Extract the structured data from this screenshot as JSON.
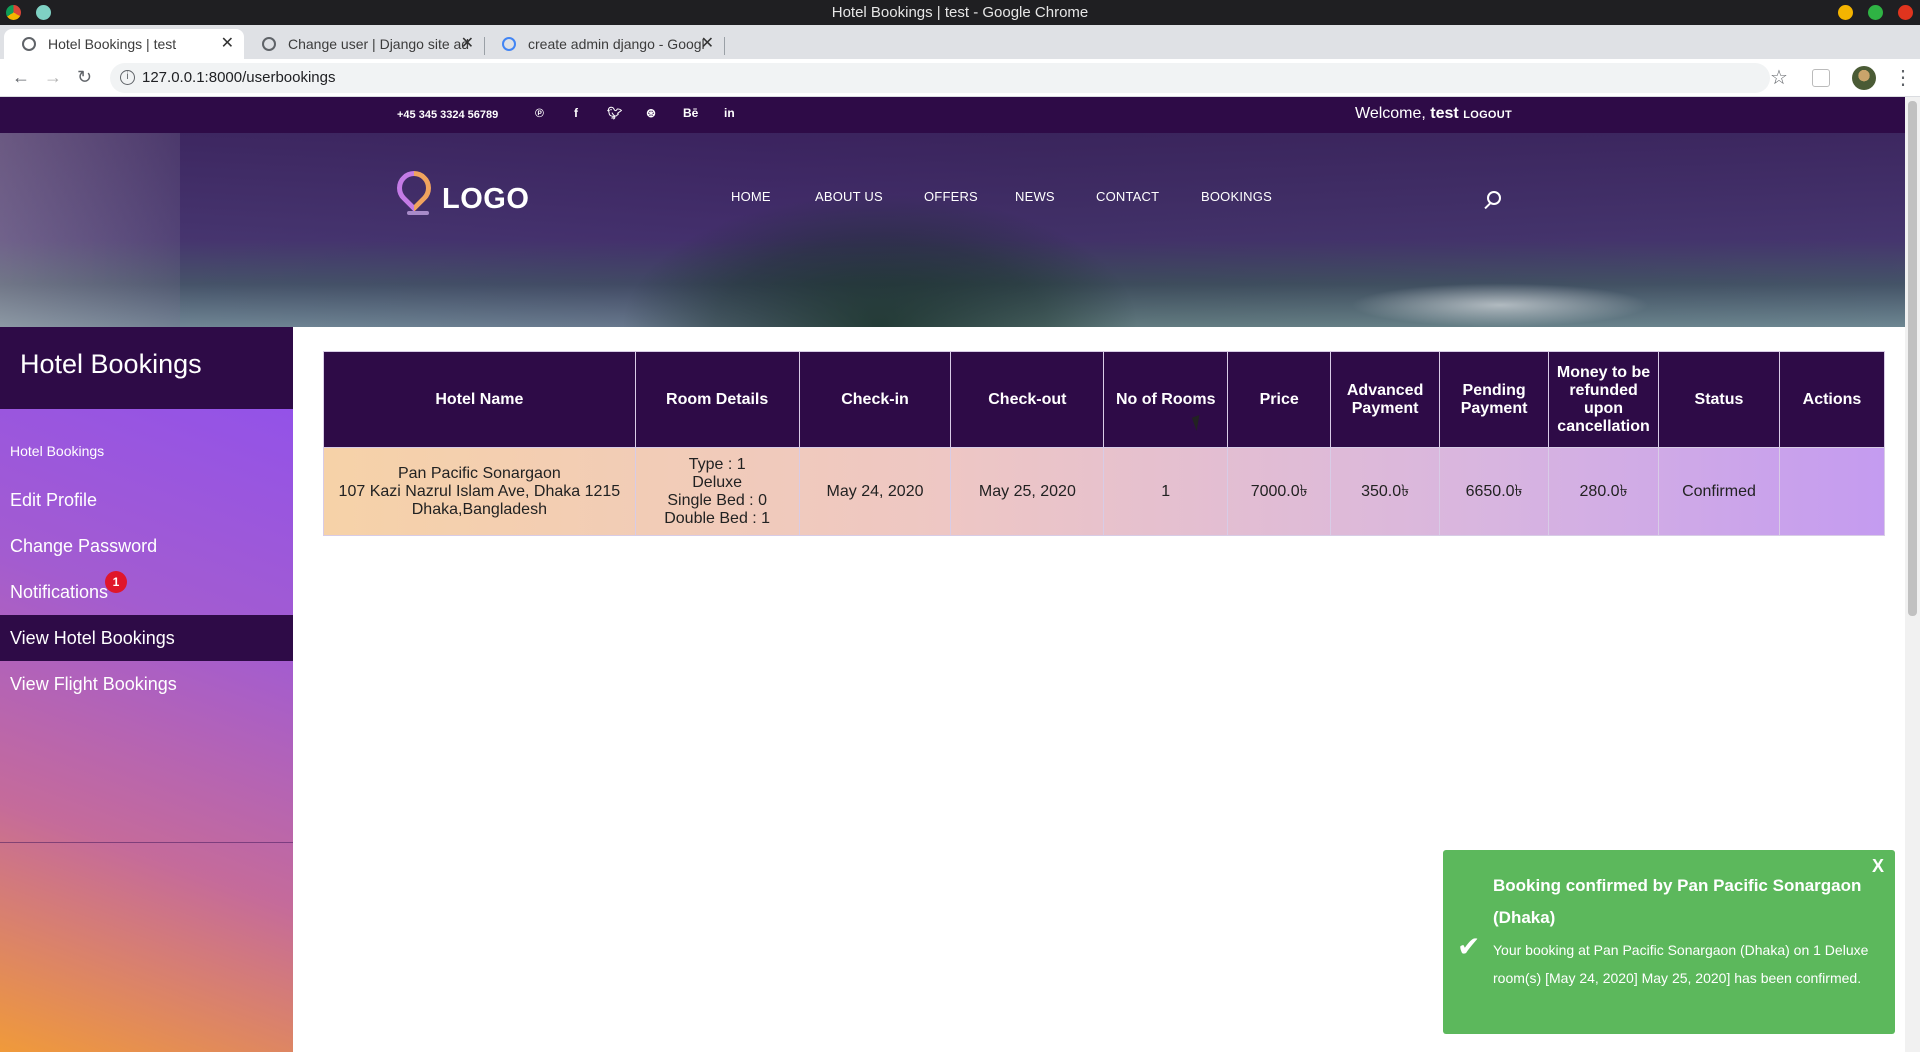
{
  "window": {
    "title": "Hotel Bookings | test - Google Chrome"
  },
  "tabs": [
    {
      "label": "Hotel Bookings | test"
    },
    {
      "label": "Change user | Django site ad"
    },
    {
      "label": "create admin django - Googl"
    }
  ],
  "address": {
    "url": "127.0.0.1:8000/userbookings"
  },
  "topbar": {
    "phone": "+45 345 3324 56789",
    "social": [
      "pinterest-icon",
      "facebook-icon",
      "twitter-icon",
      "dribbble-icon",
      "behance-icon",
      "linkedin-icon"
    ],
    "social_glyphs": {
      "behance": "Bē",
      "linkedin": "in",
      "facebook": "f"
    },
    "welcome_prefix": "Welcome,",
    "username": "test",
    "logout": "LOGOUT"
  },
  "logo": {
    "text": "LOGO"
  },
  "nav": {
    "home": "HOME",
    "about": "ABOUT US",
    "offers": "OFFERS",
    "news": "NEWS",
    "contact": "CONTACT",
    "bookings": "BOOKINGS"
  },
  "sidebar": {
    "title": "Hotel Bookings",
    "crumb": "Hotel Bookings",
    "edit_profile": "Edit Profile",
    "change_password": "Change Password",
    "notifications": "Notifications",
    "notif_count": "1",
    "view_hotel": "View Hotel Bookings",
    "view_flight": "View Flight Bookings"
  },
  "table": {
    "headers": {
      "hotel": "Hotel Name",
      "room": "Room Details",
      "checkin": "Check-in",
      "checkout": "Check-out",
      "rooms": "No of Rooms",
      "price": "Price",
      "advance": "Advanced Payment",
      "pending": "Pending Payment",
      "refund": "Money to be refunded upon cancellation",
      "status": "Status",
      "actions": "Actions"
    },
    "row": {
      "hotel_name": "Pan Pacific Sonargaon",
      "hotel_addr1": "107 Kazi Nazrul Islam Ave, Dhaka 1215",
      "hotel_addr2": "Dhaka,Bangladesh",
      "room_type": "Type : 1",
      "room_class": "Deluxe",
      "single_bed": "Single Bed : 0",
      "double_bed": "Double Bed : 1",
      "checkin": "May 24, 2020",
      "checkout": "May 25, 2020",
      "rooms": "1",
      "price": "7000.0৳",
      "advance": "350.0৳",
      "pending": "6650.0৳",
      "refund": "280.0৳",
      "status": "Confirmed",
      "actions": ""
    }
  },
  "toast": {
    "title": "Booking confirmed by Pan Pacific Sonargaon (Dhaka)",
    "message": "Your booking at Pan Pacific Sonargaon (Dhaka) on 1 Deluxe room(s) [May 24, 2020] May 25, 2020] has been confirmed.",
    "close": "X"
  },
  "colors": {
    "brand_dark": "#2e0b47",
    "toast_green": "#5cb85c",
    "badge_red": "#e0162b"
  }
}
